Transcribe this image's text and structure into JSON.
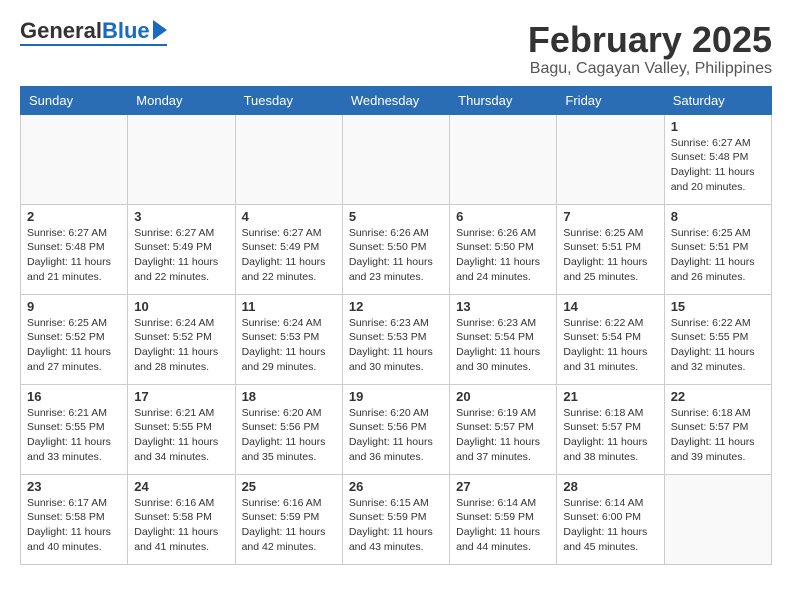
{
  "logo": {
    "general": "General",
    "blue": "Blue"
  },
  "title": "February 2025",
  "subtitle": "Bagu, Cagayan Valley, Philippines",
  "days_of_week": [
    "Sunday",
    "Monday",
    "Tuesday",
    "Wednesday",
    "Thursday",
    "Friday",
    "Saturday"
  ],
  "weeks": [
    [
      {
        "day": "",
        "info": ""
      },
      {
        "day": "",
        "info": ""
      },
      {
        "day": "",
        "info": ""
      },
      {
        "day": "",
        "info": ""
      },
      {
        "day": "",
        "info": ""
      },
      {
        "day": "",
        "info": ""
      },
      {
        "day": "1",
        "info": "Sunrise: 6:27 AM\nSunset: 5:48 PM\nDaylight: 11 hours and 20 minutes."
      }
    ],
    [
      {
        "day": "2",
        "info": "Sunrise: 6:27 AM\nSunset: 5:48 PM\nDaylight: 11 hours and 21 minutes."
      },
      {
        "day": "3",
        "info": "Sunrise: 6:27 AM\nSunset: 5:49 PM\nDaylight: 11 hours and 22 minutes."
      },
      {
        "day": "4",
        "info": "Sunrise: 6:27 AM\nSunset: 5:49 PM\nDaylight: 11 hours and 22 minutes."
      },
      {
        "day": "5",
        "info": "Sunrise: 6:26 AM\nSunset: 5:50 PM\nDaylight: 11 hours and 23 minutes."
      },
      {
        "day": "6",
        "info": "Sunrise: 6:26 AM\nSunset: 5:50 PM\nDaylight: 11 hours and 24 minutes."
      },
      {
        "day": "7",
        "info": "Sunrise: 6:25 AM\nSunset: 5:51 PM\nDaylight: 11 hours and 25 minutes."
      },
      {
        "day": "8",
        "info": "Sunrise: 6:25 AM\nSunset: 5:51 PM\nDaylight: 11 hours and 26 minutes."
      }
    ],
    [
      {
        "day": "9",
        "info": "Sunrise: 6:25 AM\nSunset: 5:52 PM\nDaylight: 11 hours and 27 minutes."
      },
      {
        "day": "10",
        "info": "Sunrise: 6:24 AM\nSunset: 5:52 PM\nDaylight: 11 hours and 28 minutes."
      },
      {
        "day": "11",
        "info": "Sunrise: 6:24 AM\nSunset: 5:53 PM\nDaylight: 11 hours and 29 minutes."
      },
      {
        "day": "12",
        "info": "Sunrise: 6:23 AM\nSunset: 5:53 PM\nDaylight: 11 hours and 30 minutes."
      },
      {
        "day": "13",
        "info": "Sunrise: 6:23 AM\nSunset: 5:54 PM\nDaylight: 11 hours and 30 minutes."
      },
      {
        "day": "14",
        "info": "Sunrise: 6:22 AM\nSunset: 5:54 PM\nDaylight: 11 hours and 31 minutes."
      },
      {
        "day": "15",
        "info": "Sunrise: 6:22 AM\nSunset: 5:55 PM\nDaylight: 11 hours and 32 minutes."
      }
    ],
    [
      {
        "day": "16",
        "info": "Sunrise: 6:21 AM\nSunset: 5:55 PM\nDaylight: 11 hours and 33 minutes."
      },
      {
        "day": "17",
        "info": "Sunrise: 6:21 AM\nSunset: 5:55 PM\nDaylight: 11 hours and 34 minutes."
      },
      {
        "day": "18",
        "info": "Sunrise: 6:20 AM\nSunset: 5:56 PM\nDaylight: 11 hours and 35 minutes."
      },
      {
        "day": "19",
        "info": "Sunrise: 6:20 AM\nSunset: 5:56 PM\nDaylight: 11 hours and 36 minutes."
      },
      {
        "day": "20",
        "info": "Sunrise: 6:19 AM\nSunset: 5:57 PM\nDaylight: 11 hours and 37 minutes."
      },
      {
        "day": "21",
        "info": "Sunrise: 6:18 AM\nSunset: 5:57 PM\nDaylight: 11 hours and 38 minutes."
      },
      {
        "day": "22",
        "info": "Sunrise: 6:18 AM\nSunset: 5:57 PM\nDaylight: 11 hours and 39 minutes."
      }
    ],
    [
      {
        "day": "23",
        "info": "Sunrise: 6:17 AM\nSunset: 5:58 PM\nDaylight: 11 hours and 40 minutes."
      },
      {
        "day": "24",
        "info": "Sunrise: 6:16 AM\nSunset: 5:58 PM\nDaylight: 11 hours and 41 minutes."
      },
      {
        "day": "25",
        "info": "Sunrise: 6:16 AM\nSunset: 5:59 PM\nDaylight: 11 hours and 42 minutes."
      },
      {
        "day": "26",
        "info": "Sunrise: 6:15 AM\nSunset: 5:59 PM\nDaylight: 11 hours and 43 minutes."
      },
      {
        "day": "27",
        "info": "Sunrise: 6:14 AM\nSunset: 5:59 PM\nDaylight: 11 hours and 44 minutes."
      },
      {
        "day": "28",
        "info": "Sunrise: 6:14 AM\nSunset: 6:00 PM\nDaylight: 11 hours and 45 minutes."
      },
      {
        "day": "",
        "info": ""
      }
    ]
  ]
}
